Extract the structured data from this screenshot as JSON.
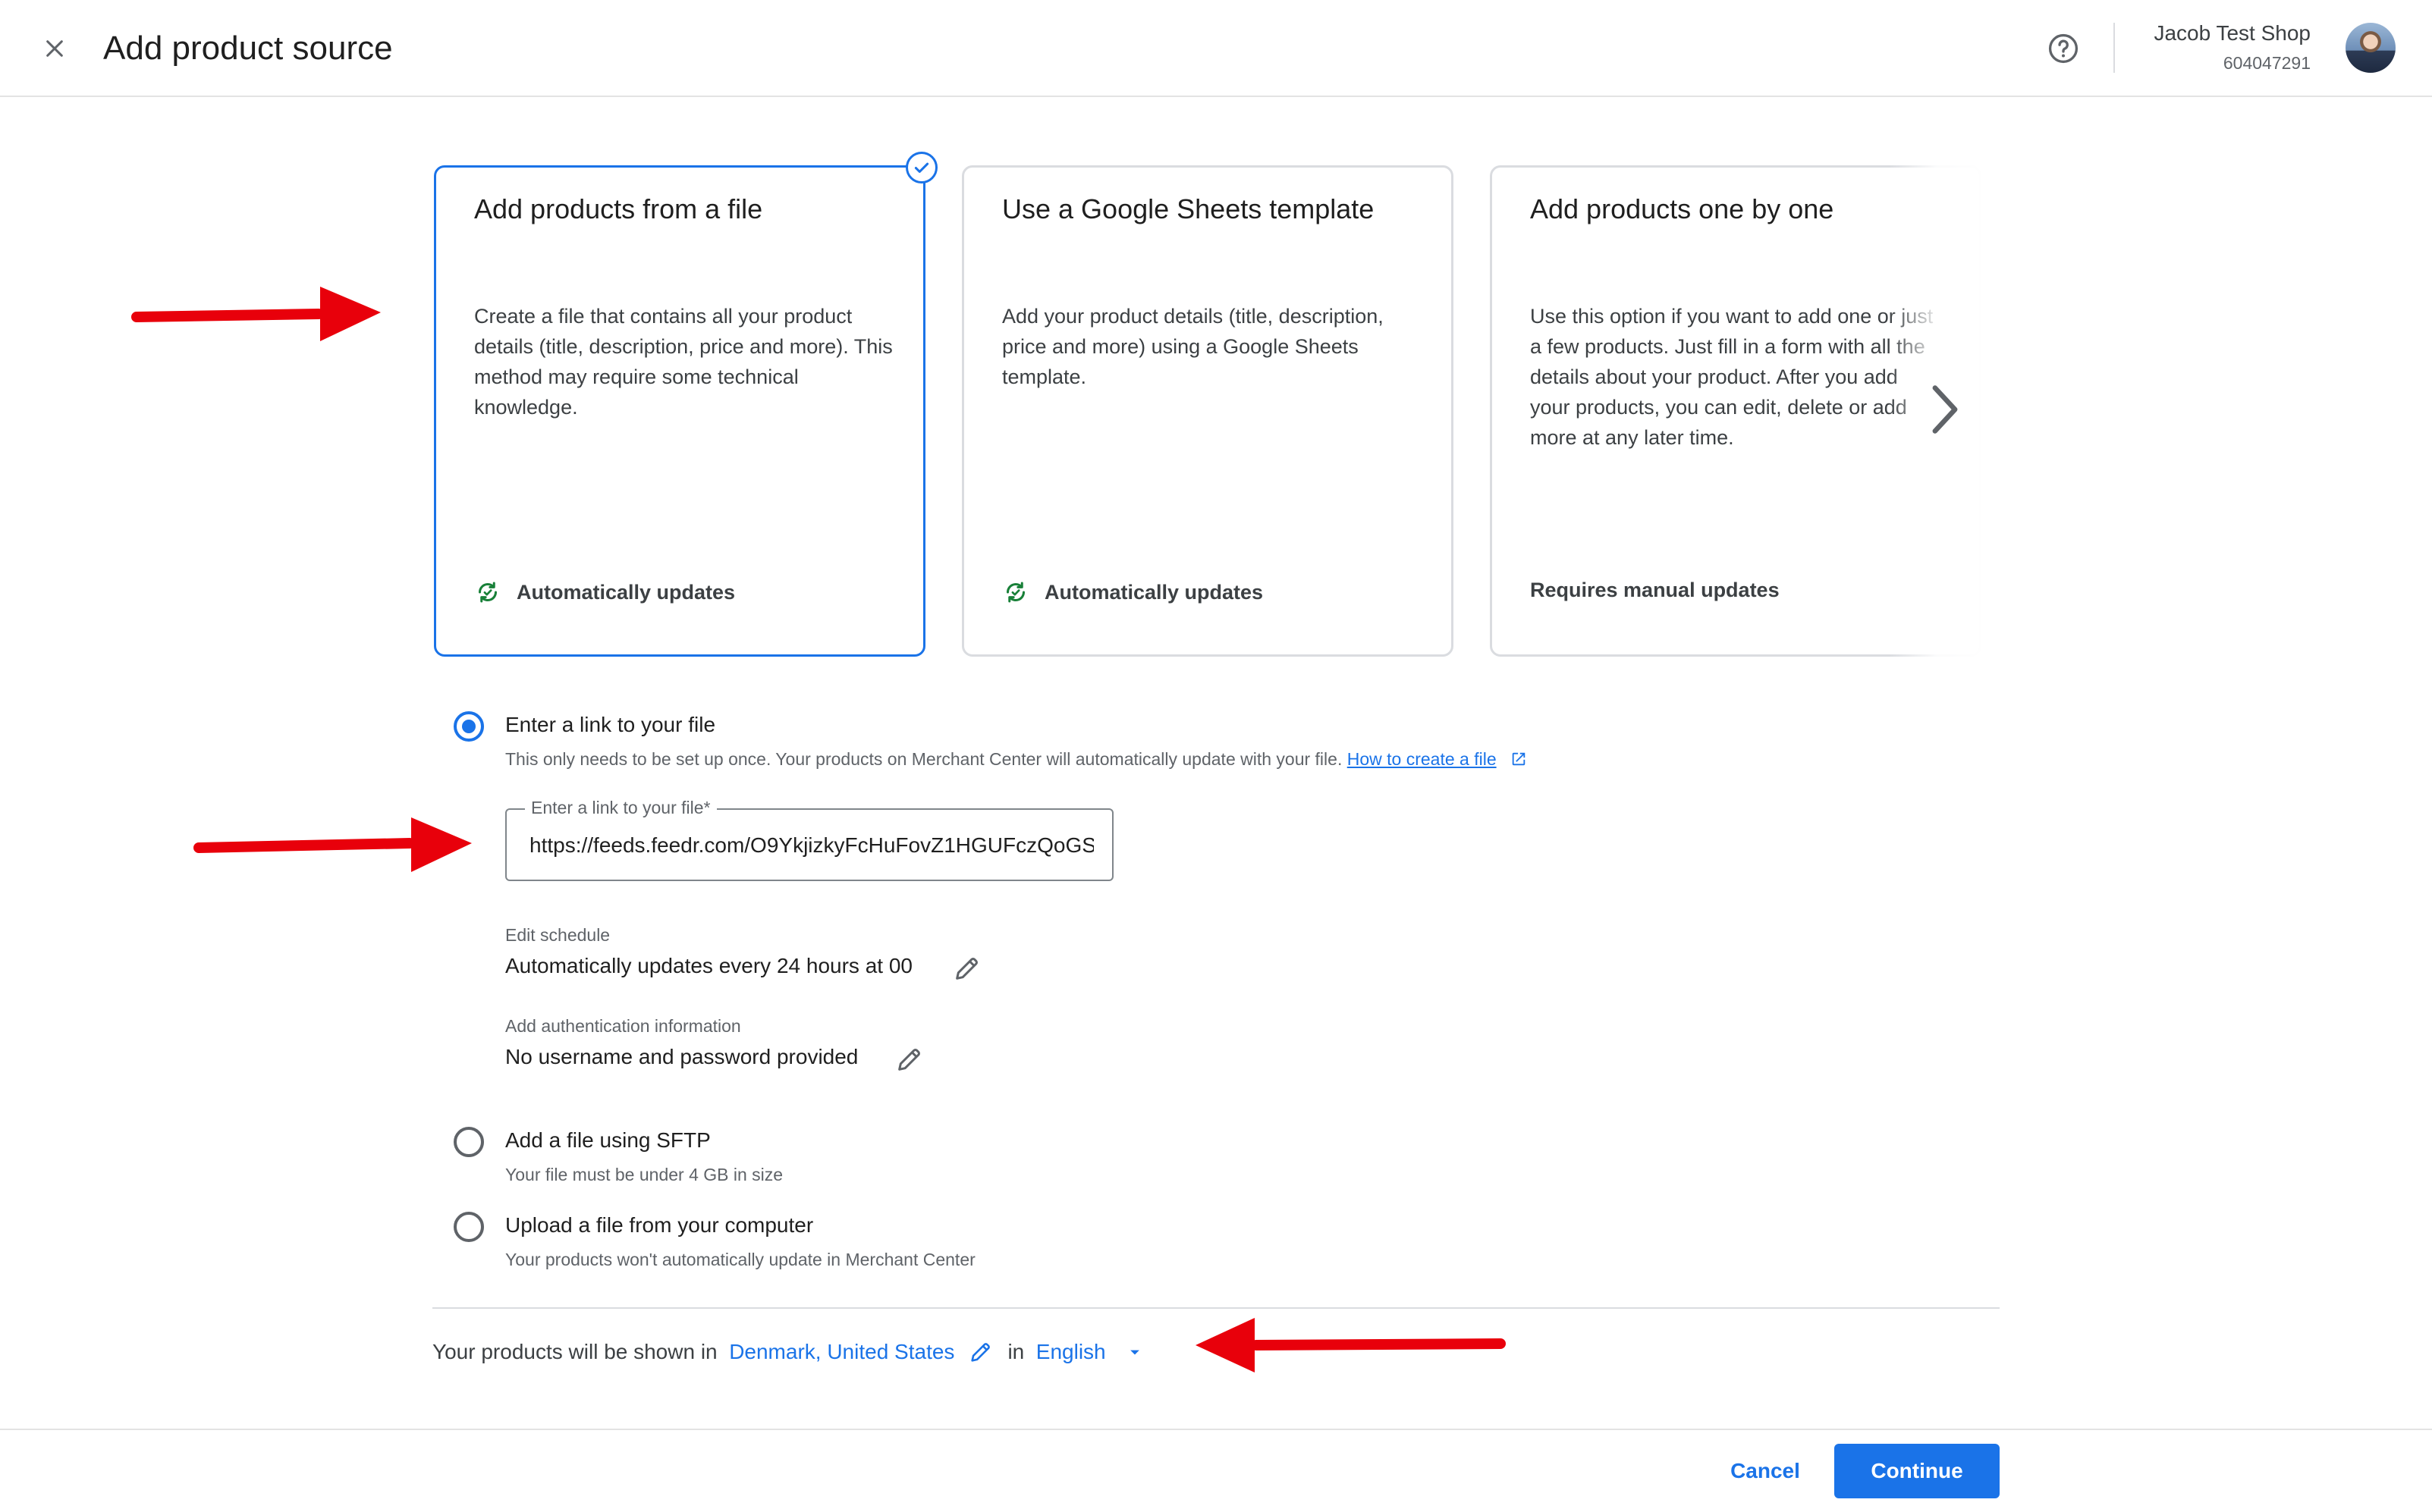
{
  "header": {
    "title": "Add product source",
    "account_name": "Jacob Test Shop",
    "account_id": "604047291"
  },
  "cards": [
    {
      "title": "Add products from a file",
      "description": "Create a file that contains all your product details (title, description, price and more). This method may require some technical knowledge.",
      "footer": "Automatically updates",
      "selected": true
    },
    {
      "title": "Use a Google Sheets template",
      "description": "Add your product details (title, description, price and more) using a Google Sheets template.",
      "footer": "Automatically updates",
      "selected": false
    },
    {
      "title": "Add products one by one",
      "description": "Use this option if you want to add one or just a few products. Just fill in a form with all the details about your product. After you add your products, you can edit, delete or add more at any later time.",
      "footer": "Requires manual updates",
      "selected": false
    }
  ],
  "options": {
    "link": {
      "label": "Enter a link to your file",
      "sub": "This only needs to be set up once. Your products on Merchant Center will automatically update with your file.",
      "help_link": "How to create a file",
      "field_label": "Enter a link to your file*",
      "field_value": "https://feeds.feedr.com/O9YkjizkyFcHuFovZ1HGUFczQoGS",
      "selected": true
    },
    "schedule": {
      "label": "Edit schedule",
      "value": "Automatically updates every 24 hours at 00"
    },
    "auth": {
      "label": "Add authentication information",
      "value": "No username and password provided"
    },
    "sftp": {
      "label": "Add a file using SFTP",
      "sub": "Your file must be under 4 GB in size",
      "selected": false
    },
    "upload": {
      "label": "Upload a file from your computer",
      "sub": "Your products won't automatically update in Merchant Center",
      "selected": false
    }
  },
  "shown_in": {
    "prefix": "Your products will be shown in",
    "countries": "Denmark, United States",
    "in_word": "in",
    "language": "English"
  },
  "footer": {
    "cancel": "Cancel",
    "continue": "Continue"
  },
  "colors": {
    "accent": "#1a73e8",
    "sync_icon": "#188038",
    "annotation_arrow": "#e8000b"
  },
  "icons": {
    "close": "close-icon",
    "help": "help-circle-icon",
    "check": "check-circle-icon",
    "sync": "sync-icon",
    "next": "chevron-right-icon",
    "external": "external-link-icon",
    "edit": "pencil-icon",
    "dropdown": "caret-down-icon"
  }
}
